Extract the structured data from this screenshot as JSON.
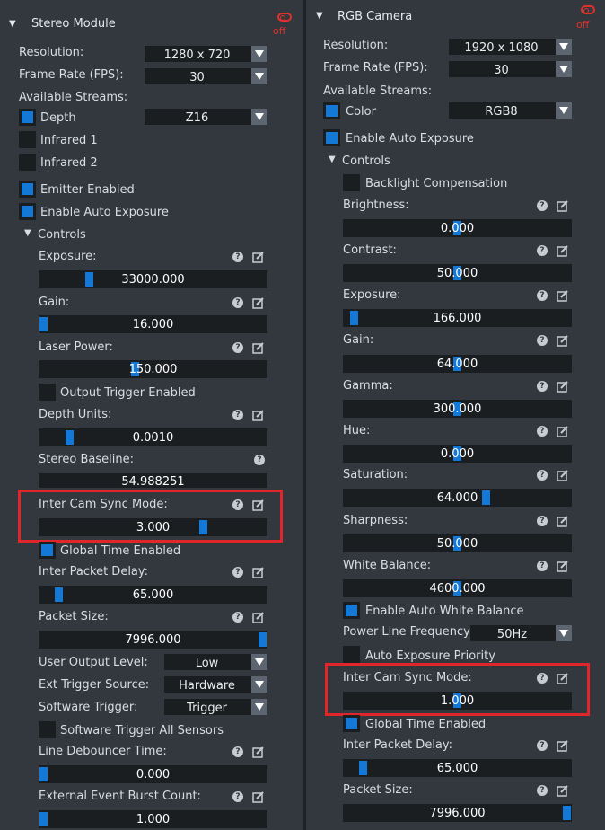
{
  "stereo": {
    "title": "Stereo Module",
    "toggle_state": "off",
    "resolution_label": "Resolution:",
    "resolution_value": "1280 x 720",
    "fps_label": "Frame Rate (FPS):",
    "fps_value": "30",
    "streams_label": "Available Streams:",
    "depth_label": "Depth",
    "depth_format": "Z16",
    "infrared1_label": "Infrared 1",
    "infrared2_label": "Infrared 2",
    "emitter_label": "Emitter Enabled",
    "auto_exposure_label": "Enable Auto Exposure",
    "controls_label": "Controls",
    "exposure_label": "Exposure:",
    "exposure_value": "33000.000",
    "exposure_fraction": 0.21,
    "gain_label": "Gain:",
    "gain_value": "16.000",
    "gain_fraction": 0.0,
    "laser_label": "Laser Power:",
    "laser_value": "150.000",
    "laser_fraction": 0.42,
    "output_trigger_label": "Output Trigger Enabled",
    "depth_units_label": "Depth Units:",
    "depth_units_value": "0.0010",
    "depth_units_fraction": 0.12,
    "baseline_label": "Stereo Baseline:",
    "baseline_value": "54.988251",
    "sync_label": "Inter Cam Sync Mode:",
    "sync_value": "3.000",
    "sync_fraction": 0.73,
    "global_time_label": "Global Time Enabled",
    "packet_delay_label": "Inter Packet Delay:",
    "packet_delay_value": "65.000",
    "packet_delay_fraction": 0.07,
    "packet_size_label": "Packet Size:",
    "packet_size_value": "7996.000",
    "packet_size_fraction": 1.0,
    "user_output_label": "User Output Level:",
    "user_output_value": "Low",
    "ext_trigger_label": "Ext Trigger Source:",
    "ext_trigger_value": "Hardware",
    "sw_trigger_label": "Software Trigger:",
    "sw_trigger_value": "Trigger",
    "sw_trigger_all_label": "Software Trigger All Sensors",
    "debouncer_label": "Line Debouncer Time:",
    "debouncer_value": "0.000",
    "debouncer_fraction": 0.0,
    "burst_label": "External Event Burst Count:",
    "burst_value": "1.000",
    "burst_fraction": 0.0
  },
  "rgb": {
    "title": "RGB Camera",
    "toggle_state": "off",
    "resolution_label": "Resolution:",
    "resolution_value": "1920 x 1080",
    "fps_label": "Frame Rate (FPS):",
    "fps_value": "30",
    "streams_label": "Available Streams:",
    "color_label": "Color",
    "color_format": "RGB8",
    "auto_exposure_label": "Enable Auto Exposure",
    "controls_label": "Controls",
    "backlight_label": "Backlight Compensation",
    "brightness_label": "Brightness:",
    "brightness_value": "0.000",
    "brightness_fraction": 0.5,
    "contrast_label": "Contrast:",
    "contrast_value": "50.000",
    "contrast_fraction": 0.5,
    "exposure_label": "Exposure:",
    "exposure_value": "166.000",
    "exposure_fraction": 0.03,
    "gain_label": "Gain:",
    "gain_value": "64.000",
    "gain_fraction": 0.5,
    "gamma_label": "Gamma:",
    "gamma_value": "300.000",
    "gamma_fraction": 0.5,
    "hue_label": "Hue:",
    "hue_value": "0.000",
    "hue_fraction": 0.5,
    "saturation_label": "Saturation:",
    "saturation_value": "64.000",
    "saturation_fraction": 0.63,
    "sharpness_label": "Sharpness:",
    "sharpness_value": "50.000",
    "sharpness_fraction": 0.5,
    "white_balance_label": "White Balance:",
    "white_balance_value": "4600.000",
    "white_balance_fraction": 0.5,
    "auto_wb_label": "Enable Auto White Balance",
    "power_line_label": "Power Line Frequency",
    "power_line_value": "50Hz",
    "ae_priority_label": "Auto Exposure Priority",
    "sync_label": "Inter Cam Sync Mode:",
    "sync_value": "1.000",
    "sync_fraction": 0.5,
    "global_time_label": "Global Time Enabled",
    "packet_delay_label": "Inter Packet Delay:",
    "packet_delay_value": "65.000",
    "packet_delay_fraction": 0.07,
    "packet_size_label": "Packet Size:",
    "packet_size_value": "7996.000",
    "packet_size_fraction": 1.0
  },
  "colors": {
    "accent": "#1479d6",
    "panel": "#33383e",
    "field": "#1b1e21",
    "highlight": "#e0262a",
    "off": "#e0302e"
  }
}
